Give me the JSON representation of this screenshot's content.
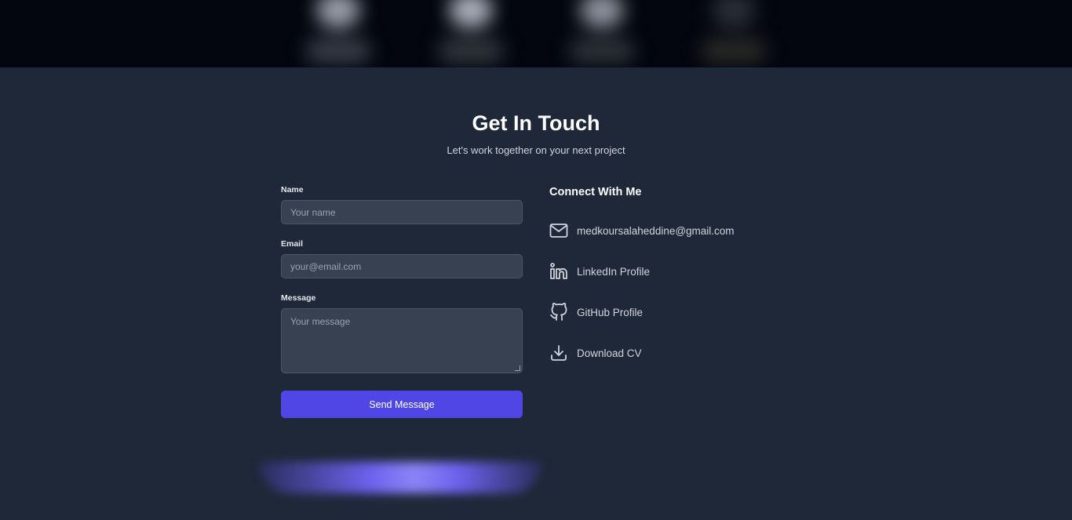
{
  "contact": {
    "title": "Get In Touch",
    "subtitle": "Let's work together on your next project"
  },
  "form": {
    "name_label": "Name",
    "name_placeholder": "Your name",
    "email_label": "Email",
    "email_placeholder": "your@email.com",
    "message_label": "Message",
    "message_placeholder": "Your message",
    "submit_label": "Send Message"
  },
  "connect": {
    "heading": "Connect With Me",
    "links": [
      {
        "icon": "mail-icon",
        "label": "medkoursalaheddine@gmail.com"
      },
      {
        "icon": "linkedin-icon",
        "label": "LinkedIn Profile"
      },
      {
        "icon": "github-icon",
        "label": "GitHub Profile"
      },
      {
        "icon": "download-icon",
        "label": "Download CV"
      }
    ]
  },
  "colors": {
    "background": "#1f2838",
    "top_band": "#03060f",
    "accent": "#4f46e5",
    "input_bg": "#374151"
  }
}
